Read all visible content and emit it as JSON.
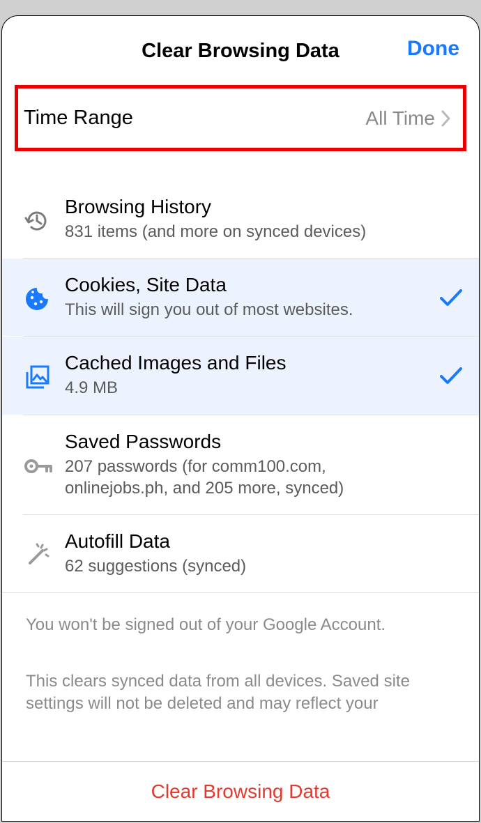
{
  "header": {
    "title": "Clear Browsing Data",
    "done": "Done"
  },
  "timeRange": {
    "label": "Time Range",
    "value": "All Time"
  },
  "items": {
    "history": {
      "title": "Browsing History",
      "sub": "831 items (and more on synced devices)"
    },
    "cookies": {
      "title": "Cookies, Site Data",
      "sub": "This will sign you out of most websites."
    },
    "cache": {
      "title": "Cached Images and Files",
      "sub": "4.9 MB"
    },
    "passwords": {
      "title": "Saved Passwords",
      "sub": "207 passwords (for comm100.com, onlinejobs.ph, and 205 more, synced)"
    },
    "autofill": {
      "title": "Autofill Data",
      "sub": "62 suggestions (synced)"
    }
  },
  "footnotes": {
    "a": "You won't be signed out of your Google Account.",
    "b": "This clears synced data from all devices. Saved site settings will not be deleted and may reflect your"
  },
  "action": "Clear Browsing Data"
}
